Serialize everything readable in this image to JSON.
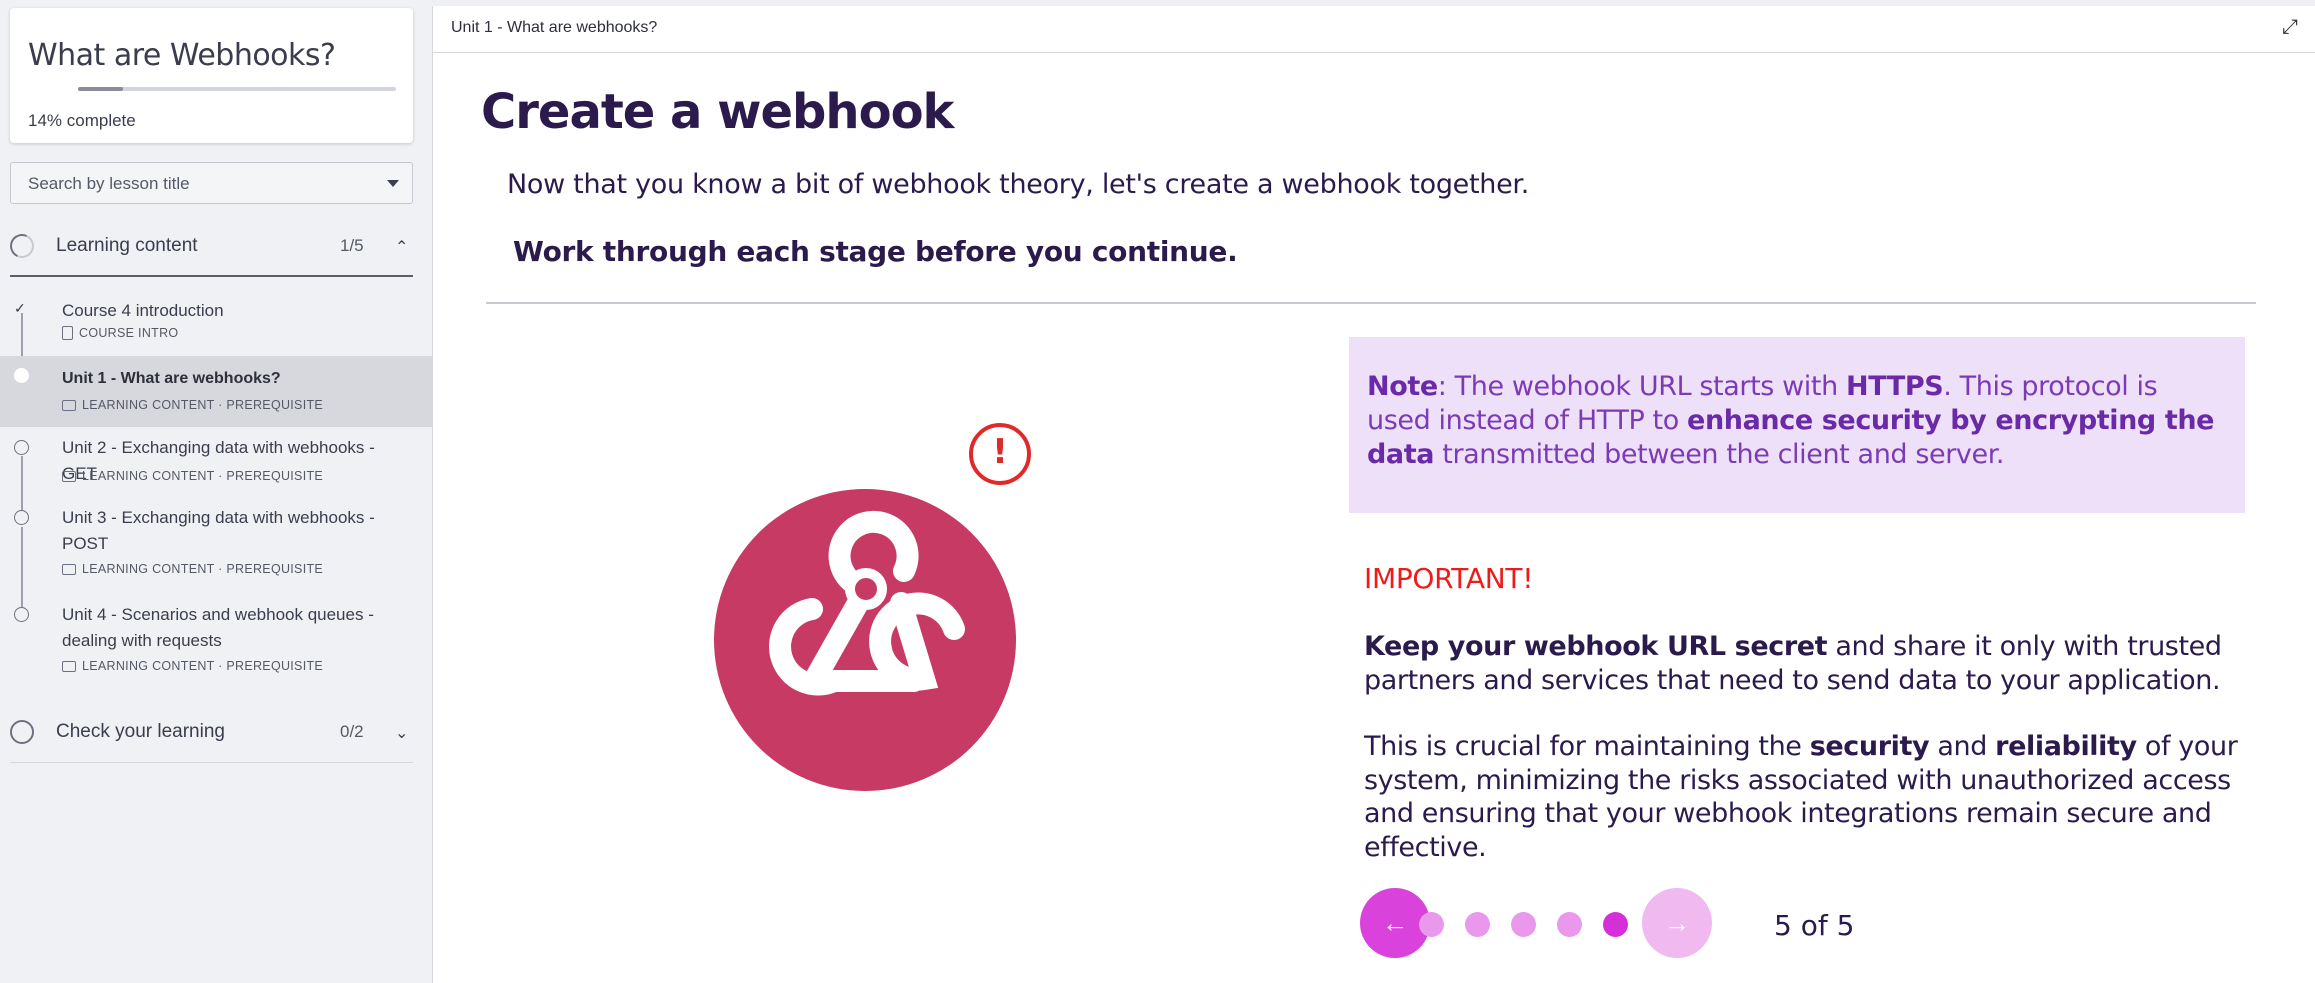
{
  "sidebar": {
    "course_title": "What are Webhooks?",
    "progress": {
      "percent": 14,
      "percent_label": "14%",
      "suffix": " complete"
    },
    "search_placeholder": "Search by lesson title",
    "sections": [
      {
        "title": "Learning content",
        "count": "1/5",
        "chevron": "^"
      },
      {
        "title": "Check your learning",
        "count": "0/2",
        "chevron": "v"
      }
    ],
    "lessons": [
      {
        "title": "Course 4 introduction",
        "meta": "COURSE INTRO",
        "status": "complete"
      },
      {
        "title": "Unit 1 - What are webhooks?",
        "meta": "LEARNING CONTENT · PREREQUISITE",
        "status": "current"
      },
      {
        "title": "Unit 2 - Exchanging data with webhooks - GET",
        "meta": "LEARNING CONTENT · PREREQUISITE",
        "status": "not-started"
      },
      {
        "title": "Unit 3 - Exchanging data with webhooks - POST",
        "meta": "LEARNING CONTENT · PREREQUISITE",
        "status": "not-started"
      },
      {
        "title": "Unit 4 - Scenarios and webhook queues - dealing with requests",
        "meta": "LEARNING CONTENT · PREREQUISITE",
        "status": "not-started"
      }
    ]
  },
  "main": {
    "breadcrumb": "Unit 1 - What are webhooks?",
    "expand_icon": "expand-icon",
    "page_title": "Create a webhook",
    "intro": "Now that you know a bit of webhook theory, let's create a webhook together.",
    "instruction": "Work through each stage before you continue.",
    "note": {
      "label": "Note",
      "text1": ": The webhook URL starts with ",
      "bold1": "HTTPS",
      "text2": ". This protocol is used instead of HTTP to ",
      "bold2": "enhance security by encrypting the data",
      "text3": " transmitted between the client and server."
    },
    "important_label": "IMPORTANT!",
    "para1": {
      "bold": "Keep your webhook URL secret",
      "text": " and share it only with trusted partners and services that need to send data to your application."
    },
    "para2": {
      "text1": "This is crucial for maintaining the ",
      "bold1": "security",
      "text2": " and ",
      "bold2": "reliability",
      "text3": " of your system, minimizing the risks associated with unauthorized access and ensuring that your webhook integrations remain secure and effective."
    },
    "pager": {
      "prev_icon": "arrow-left-icon",
      "next_icon": "arrow-right-icon",
      "current": 5,
      "total": 5,
      "label": "5 of 5"
    },
    "colors": {
      "accent": "#d943dc",
      "title": "#2b1a4c",
      "webhook_logo": "#c73a63",
      "important": "#ef1b1b",
      "note_bg": "#ede0f8"
    }
  }
}
